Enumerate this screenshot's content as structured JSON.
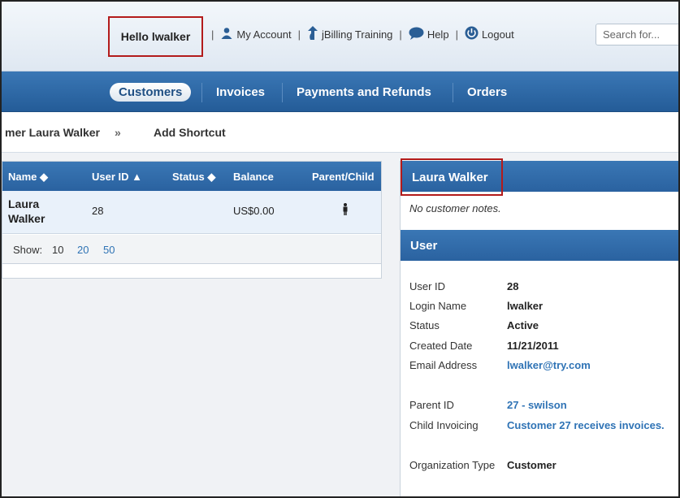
{
  "header": {
    "greeting": "Hello lwalker",
    "links": [
      {
        "label": "My Account",
        "icon": "user-icon"
      },
      {
        "label": "jBilling Training",
        "icon": "arrow-up-icon"
      },
      {
        "label": "Help",
        "icon": "speech-bubble-icon"
      },
      {
        "label": "Logout",
        "icon": "power-icon"
      }
    ],
    "search_placeholder": "Search for..."
  },
  "nav": {
    "tabs": [
      "Customers",
      "Invoices",
      "Payments and Refunds",
      "Orders"
    ],
    "active": "Customers"
  },
  "breadcrumb": {
    "current": "mer Laura Walker",
    "separator": "»",
    "shortcut": "Add Shortcut"
  },
  "table": {
    "columns": [
      "Name ◆",
      "User ID ▲",
      "Status ◆",
      "Balance",
      "Parent/Child"
    ],
    "rows": [
      {
        "name_line1": "Laura",
        "name_line2": "Walker",
        "user_id": "28",
        "status": "",
        "balance": "US$0.00",
        "parent_child_icon": "person-icon"
      }
    ],
    "pager": {
      "label": "Show:",
      "options": [
        "10",
        "20",
        "50"
      ],
      "selected": "10"
    }
  },
  "details": {
    "customer_name": "Laura Walker",
    "notes": "No customer notes.",
    "section_title": "User",
    "fields": [
      {
        "label": "User ID",
        "value": "28"
      },
      {
        "label": "Login Name",
        "value": "lwalker"
      },
      {
        "label": "Status",
        "value": "Active"
      },
      {
        "label": "Created Date",
        "value": "11/21/2011"
      },
      {
        "label": "Email Address",
        "value": "lwalker@try.com"
      },
      {
        "label": "Parent ID",
        "value": "27 - swilson"
      },
      {
        "label": "Child Invoicing",
        "value": "Customer 27 receives invoices."
      },
      {
        "label": "Organization Type",
        "value": "Customer"
      }
    ]
  },
  "colors": {
    "nav_blue": "#2a62a0",
    "highlight_red": "#b31b1b",
    "link_blue": "#2f73b5"
  }
}
